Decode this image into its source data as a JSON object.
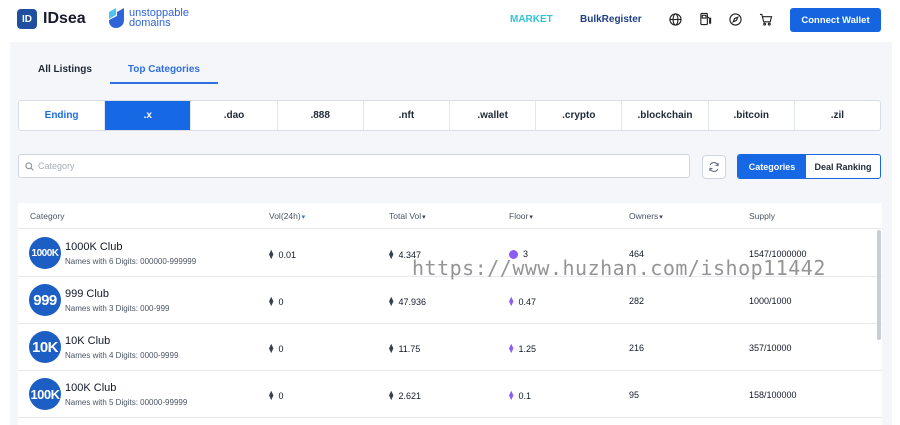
{
  "header": {
    "brand": "IDsea",
    "brand_mark": "ID",
    "partner": {
      "line1": "unstoppable",
      "line2": "domains"
    },
    "nav": {
      "market": "MARKET",
      "bulk_register": "BulkRegister"
    },
    "icons": [
      "globe-icon",
      "gas-pump-icon",
      "compass-icon",
      "cart-icon"
    ],
    "connect_wallet": "Connect Wallet"
  },
  "tabs": [
    {
      "label": "All Listings",
      "active": false
    },
    {
      "label": "Top Categories",
      "active": true
    }
  ],
  "categories": [
    {
      "label": "Ending",
      "state": "ending"
    },
    {
      "label": ".x",
      "state": "selected"
    },
    {
      "label": ".dao",
      "state": ""
    },
    {
      "label": ".888",
      "state": ""
    },
    {
      "label": ".nft",
      "state": ""
    },
    {
      "label": ".wallet",
      "state": ""
    },
    {
      "label": ".crypto",
      "state": ""
    },
    {
      "label": ".blockchain",
      "state": ""
    },
    {
      "label": ".bitcoin",
      "state": ""
    },
    {
      "label": ".zil",
      "state": ""
    }
  ],
  "search": {
    "placeholder": "Category",
    "value": ""
  },
  "view_toggle": {
    "categories": "Categories",
    "deal_ranking": "Deal Ranking",
    "selected": "Categories"
  },
  "table": {
    "headers": {
      "category": "Category",
      "vol24h": "Vol(24h)",
      "total_vol": "Total Vol",
      "floor": "Floor",
      "owners": "Owners",
      "supply": "Supply"
    },
    "rows": [
      {
        "avatar": "1000K",
        "name": "1000K Club",
        "desc": "Names with 6 Digits: 000000-999999",
        "vol24h": "0.01",
        "total_vol": "4.347",
        "floor": "3",
        "owners": "464",
        "supply": "1547/1000000"
      },
      {
        "avatar": "999",
        "name": "999 Club",
        "desc": "Names with 3 Digits: 000-999",
        "vol24h": "0",
        "total_vol": "47.936",
        "floor": "0.47",
        "owners": "282",
        "supply": "1000/1000"
      },
      {
        "avatar": "10K",
        "name": "10K Club",
        "desc": "Names with 4 Digits: 0000-9999",
        "vol24h": "0",
        "total_vol": "11.75",
        "floor": "1.25",
        "owners": "216",
        "supply": "357/10000"
      },
      {
        "avatar": "100K",
        "name": "100K Club",
        "desc": "Names with 5 Digits: 00000-99999",
        "vol24h": "0",
        "total_vol": "2.621",
        "floor": "0.1",
        "owners": "95",
        "supply": "158/100000"
      }
    ]
  },
  "watermark": "https://www.huzhan.com/ishop11442",
  "colors": {
    "primary": "#1768e4",
    "market": "#35c3d6",
    "avatar": "#1d5ec4"
  }
}
